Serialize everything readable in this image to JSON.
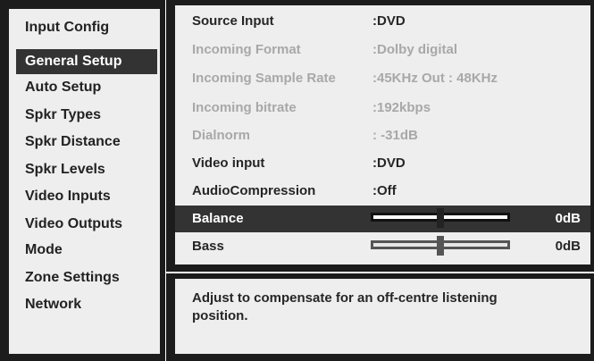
{
  "menu": {
    "items": [
      {
        "label": "Input Config",
        "selected": false
      },
      {
        "label": "General Setup",
        "selected": true
      },
      {
        "label": "Auto Setup",
        "selected": false
      },
      {
        "label": "Spkr Types",
        "selected": false
      },
      {
        "label": "Spkr Distance",
        "selected": false
      },
      {
        "label": "Spkr Levels",
        "selected": false
      },
      {
        "label": "Video Inputs",
        "selected": false
      },
      {
        "label": "Video Outputs",
        "selected": false
      },
      {
        "label": "Mode",
        "selected": false
      },
      {
        "label": "Zone Settings",
        "selected": false
      },
      {
        "label": "Network",
        "selected": false
      }
    ]
  },
  "settings": {
    "rows": [
      {
        "label": "Source Input",
        "value": ":DVD",
        "state": "normal"
      },
      {
        "label": "Incoming Format",
        "value": ":Dolby digital",
        "state": "dim"
      },
      {
        "label": "Incoming Sample Rate",
        "value": ":45KHz Out : 48KHz",
        "state": "dim"
      },
      {
        "label": "Incoming bitrate",
        "value": ":192kbps",
        "state": "dim"
      },
      {
        "label": "Dialnorm",
        "value": ": -31dB",
        "state": "dim"
      },
      {
        "label": "Video input",
        "value": ":DVD",
        "state": "normal"
      },
      {
        "label": "AudioCompression",
        "value": ":Off",
        "state": "normal"
      }
    ],
    "sliders": [
      {
        "label": "Balance",
        "value_text": "0dB",
        "level": 0.5,
        "selected": true
      },
      {
        "label": "Bass",
        "value_text": "0dB",
        "level": 0.5,
        "selected": false
      }
    ]
  },
  "description": {
    "text": "Adjust to compensate for an off-centre listening position."
  },
  "colors": {
    "frame": "#1c1c1c",
    "panel": "#eeeeee",
    "highlight": "#333333",
    "text": "#262626",
    "dim_text": "#a8a8a8"
  }
}
